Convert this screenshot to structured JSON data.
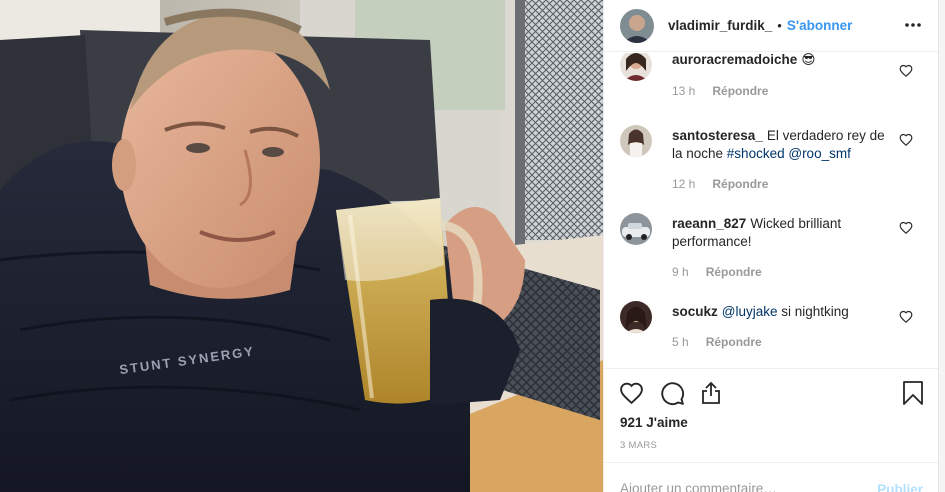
{
  "post": {
    "username": "vladimir_furdik_",
    "separator": "•",
    "follow_label": "S'abonner",
    "more_icon": "more-horizontal-icon",
    "jacket_logo": "STUNT SYNERGY"
  },
  "comments": [
    {
      "user": "auroracremadoiche",
      "text": "😎",
      "time": "13 h",
      "reply": "Répondre"
    },
    {
      "user": "santosteresa_",
      "text": "El verdadero rey de la noche ",
      "tag1": "#shocked",
      "tag2": "@roo_smf",
      "time": "12 h",
      "reply": "Répondre"
    },
    {
      "user": "raeann_827",
      "text": "Wicked brilliant performance!",
      "time": "9 h",
      "reply": "Répondre"
    },
    {
      "user": "socukz",
      "tag1": "@luyjake",
      "text": " si nightking",
      "time": "5 h",
      "reply": "Répondre"
    }
  ],
  "actions": {
    "likes": "921 J'aime",
    "date": "3 MARS",
    "icons": [
      "heart-icon",
      "comment-icon",
      "share-icon",
      "bookmark-icon"
    ]
  },
  "add_comment": {
    "placeholder": "Ajouter un commentaire…",
    "publish_label": "Publier"
  },
  "colors": {
    "accent": "#3897f0",
    "hashtag": "#003569",
    "muted": "#999999",
    "publish_disabled": "#b2dffc"
  }
}
